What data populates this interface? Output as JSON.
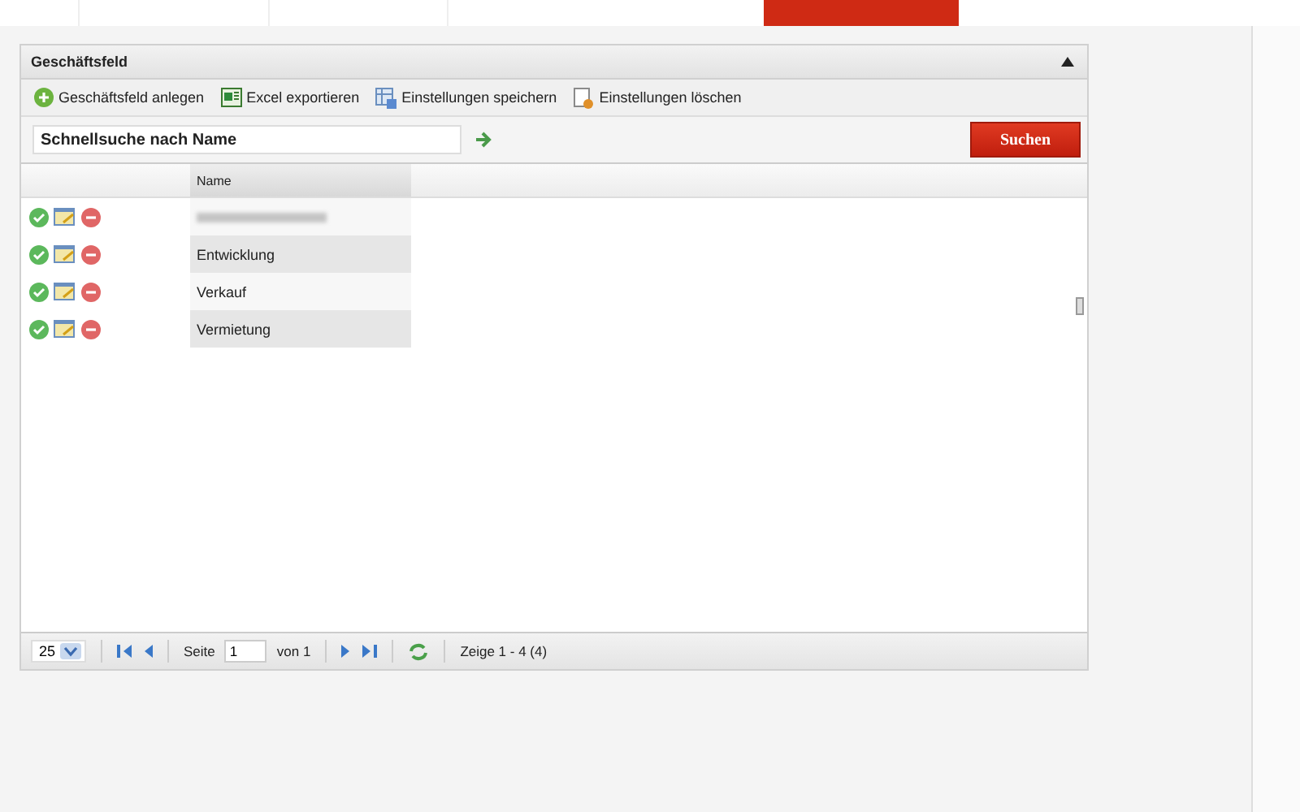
{
  "panel": {
    "title": "Geschäftsfeld",
    "collapsed": false
  },
  "toolbar": [
    {
      "label": "Geschäftsfeld anlegen",
      "kind": "add"
    },
    {
      "label": "Excel exportieren",
      "kind": "excel"
    },
    {
      "label": "Einstellungen speichern",
      "kind": "save"
    },
    {
      "label": "Einstellungen löschen",
      "kind": "delete"
    }
  ],
  "search": {
    "value": "Schnellsuche nach Name",
    "button": "Suchen"
  },
  "table": {
    "columns": [
      "Name"
    ],
    "rows": [
      {
        "name": "",
        "redacted": true
      },
      {
        "name": "Entwicklung",
        "redacted": false
      },
      {
        "name": "Verkauf",
        "redacted": false
      },
      {
        "name": "Vermietung",
        "redacted": false
      }
    ]
  },
  "pager": {
    "page_size": "25",
    "page_label": "Seite",
    "page": "1",
    "of_label": "von 1",
    "summary": "Zeige 1 - 4 (4)"
  }
}
